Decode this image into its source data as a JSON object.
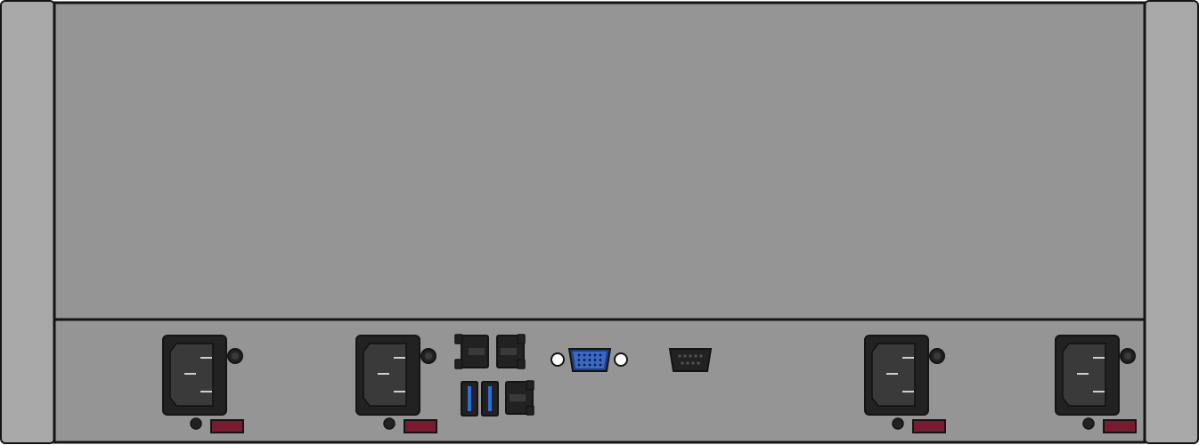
{
  "chassis": {
    "view": "rear",
    "colors": {
      "body": "#959595",
      "ear": "#a8a8a8",
      "outline": "#141414",
      "port": "#222222",
      "port_inner": "#3a3a3a",
      "usb_accent": "#2a6fe0",
      "vga_body": "#1f3f7a",
      "vga_face": "#3a68c4",
      "fuse_latch": "#7a1a30",
      "screw_hole": "#ffffff"
    }
  },
  "power_modules": [
    {
      "id": "psu-1",
      "inlet": "c14-power-inlet",
      "latch": "release-latch"
    },
    {
      "id": "psu-2",
      "inlet": "c14-power-inlet",
      "latch": "release-latch"
    },
    {
      "id": "psu-3",
      "inlet": "c14-power-inlet",
      "latch": "release-latch"
    },
    {
      "id": "psu-4",
      "inlet": "c14-power-inlet",
      "latch": "release-latch"
    }
  ],
  "io_panel": {
    "ethernet_ports": 3,
    "usb_ports": 2,
    "vga_ports": 1,
    "serial_ports": 1,
    "icons": {
      "ethernet": "ethernet-port-icon",
      "usb": "usb-port-icon",
      "vga": "vga-port-icon",
      "serial": "serial-port-icon",
      "power": "power-inlet-icon"
    }
  }
}
